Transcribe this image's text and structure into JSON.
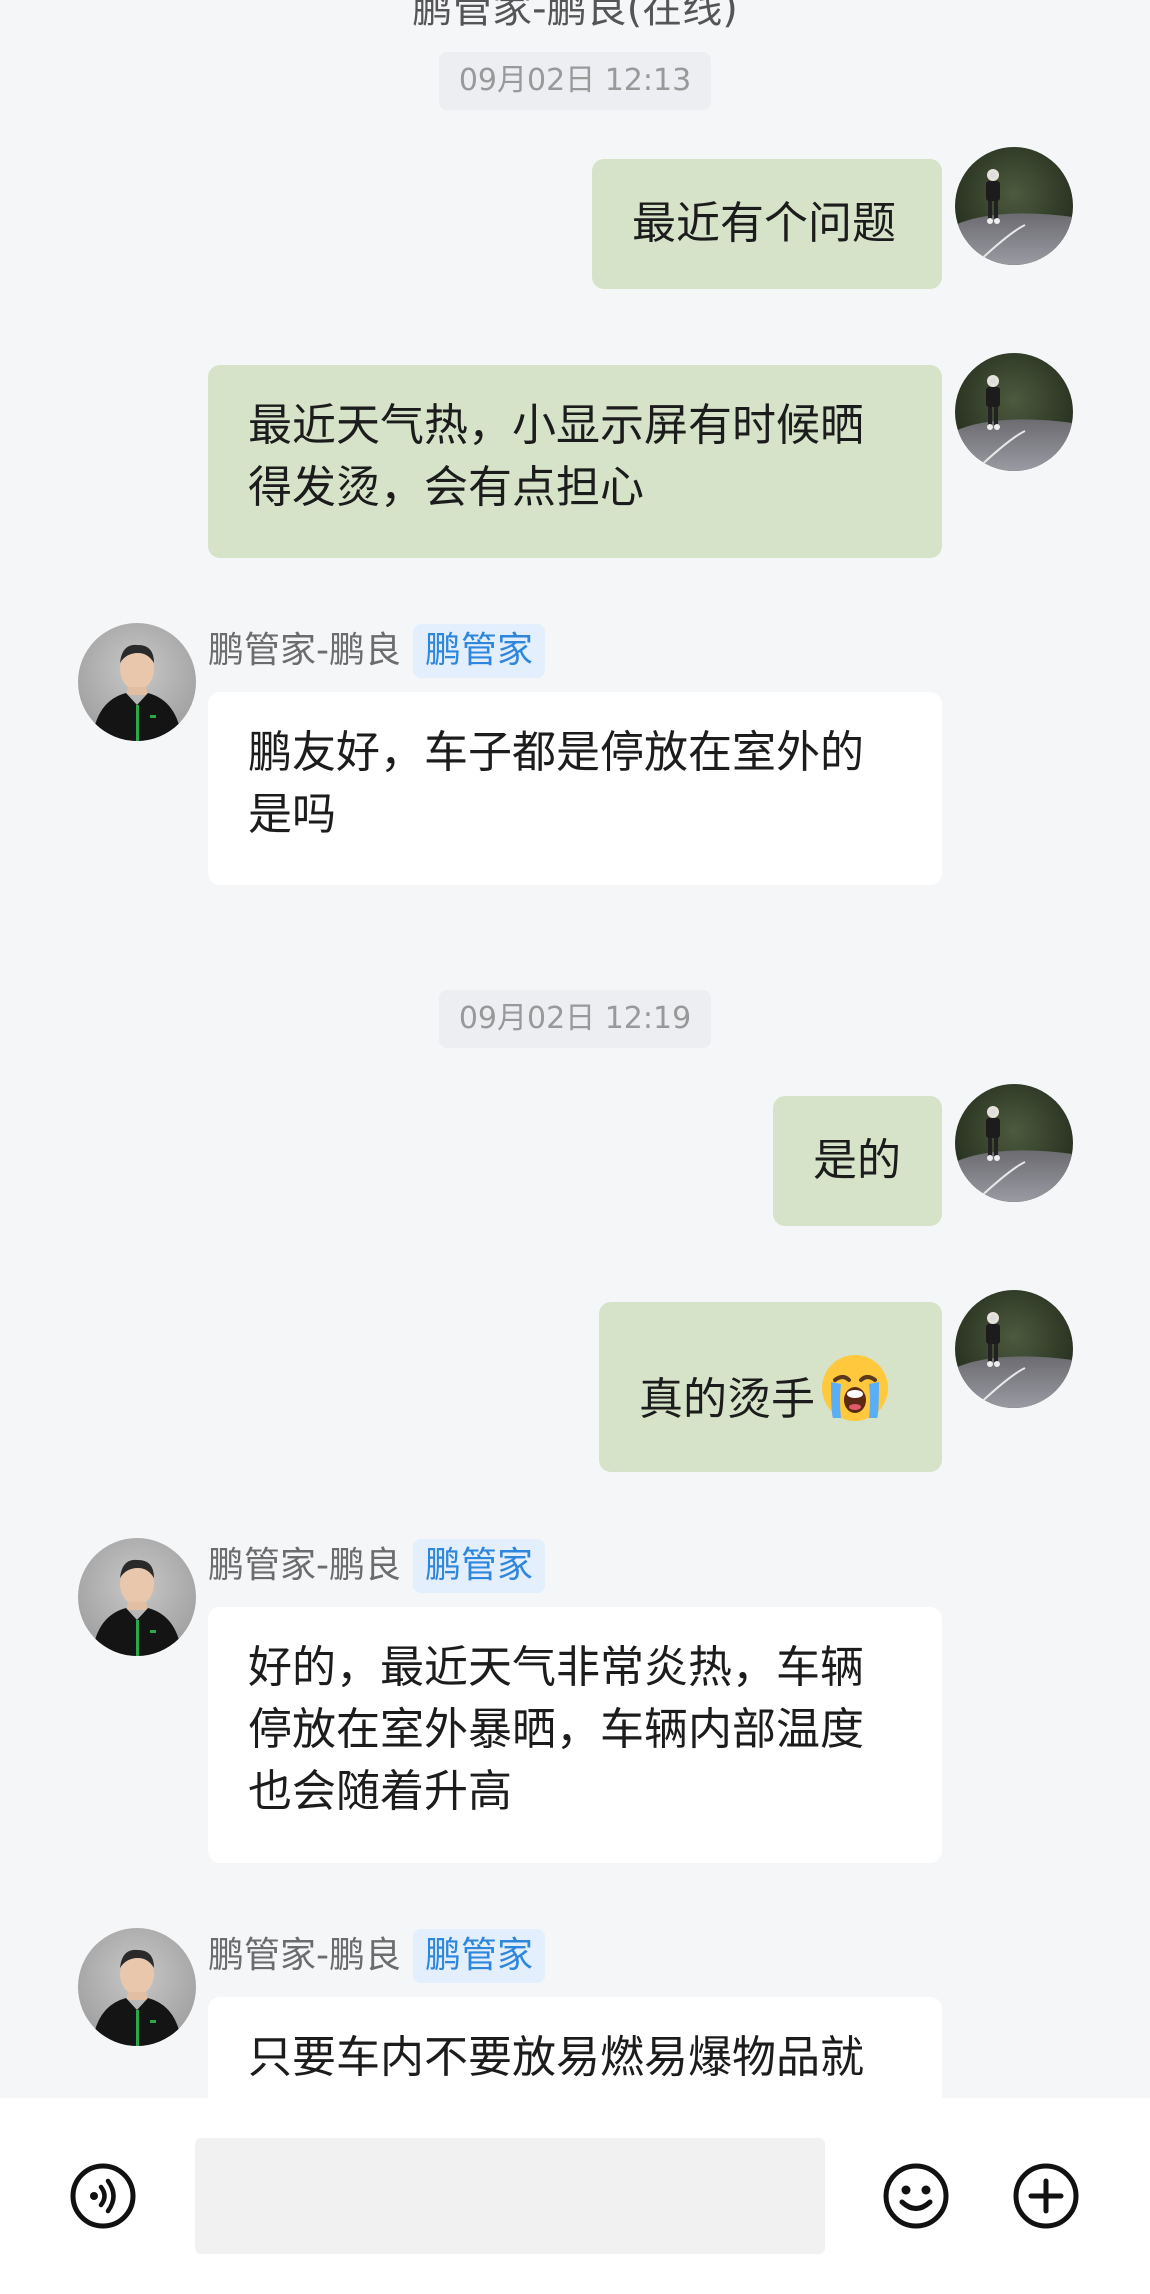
{
  "header": {
    "title_partial": "鹏管家-鹏良(在线)"
  },
  "timestamps": [
    "09月02日 12:13",
    "09月02日 12:19"
  ],
  "messages": [
    {
      "side": "me",
      "text": "最近有个问题"
    },
    {
      "side": "me",
      "text": "最近天气热，小显示屏有时候晒得发烫，会有点担心"
    },
    {
      "side": "agent",
      "sender": "鹏管家-鹏良",
      "tag": "鹏管家",
      "text": "鹏友好，车子都是停放在室外的是吗"
    },
    {
      "side": "me",
      "text": "是的"
    },
    {
      "side": "me",
      "text": "真的烫手",
      "emoji": "loudly-crying-face"
    },
    {
      "side": "agent",
      "sender": "鹏管家-鹏良",
      "tag": "鹏管家",
      "text": "好的，最近天气非常炎热，车辆停放在室外暴晒，车辆内部温度也会随着升高"
    },
    {
      "side": "agent",
      "sender": "鹏管家-鹏良",
      "tag": "鹏管家",
      "text": "只要车内不要放易燃易爆物品就"
    }
  ],
  "input_bar": {
    "voice_icon": "voice-icon",
    "emoji_icon": "emoji-icon",
    "add_icon": "plus-icon",
    "input_value": ""
  },
  "colors": {
    "background": "#f5f6f8",
    "my_bubble": "#d6e3c9",
    "agent_bubble": "#ffffff",
    "tag_text": "#2f86dd",
    "tag_bg": "#e3effc"
  }
}
